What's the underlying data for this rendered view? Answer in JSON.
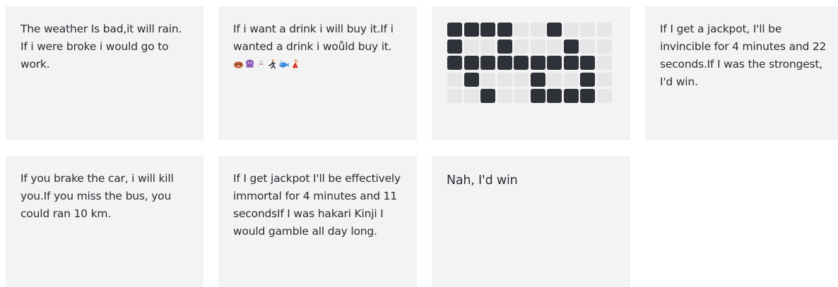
{
  "cards": [
    {
      "text": "The weather Is bad,it will rain. If i were broke i would go to work."
    },
    {
      "text": "If i want a drink i will buy it.If i wanted a drink i woůld buy it.",
      "emojis": [
        "sloth-icon",
        "octopus-icon",
        "snowman-icon",
        "person-running-icon",
        "fish-icon",
        "dancer-icon"
      ]
    },
    {
      "pixels": [
        [
          1,
          1,
          1,
          1,
          0,
          0,
          1,
          0,
          0,
          0
        ],
        [
          1,
          0,
          0,
          1,
          0,
          0,
          0,
          1,
          0,
          0
        ],
        [
          1,
          1,
          1,
          1,
          1,
          1,
          1,
          1,
          1,
          0
        ],
        [
          0,
          1,
          0,
          0,
          0,
          1,
          0,
          0,
          1,
          0
        ],
        [
          0,
          0,
          1,
          0,
          0,
          1,
          1,
          1,
          1,
          0
        ]
      ]
    },
    {
      "text": "If I get a jackpot, I'll be invincible for 4 minutes and 22 seconds.If I was the strongest, I'd win."
    },
    {
      "text": "If you brake the car, i will kill you.If you miss the bus, you could ran 10 km."
    },
    {
      "text": "If I get jackpot I'll be effectively immortal for 4 minutes and 11 secondsIf I was hakari Kinji I would gamble all day long."
    },
    {
      "text": "Nah, I'd win"
    }
  ],
  "colors": {
    "card_bg": "#f3f3f4",
    "cell_off": "#e6e6e8",
    "cell_on": "#2f3138",
    "text": "#2b2b33"
  }
}
